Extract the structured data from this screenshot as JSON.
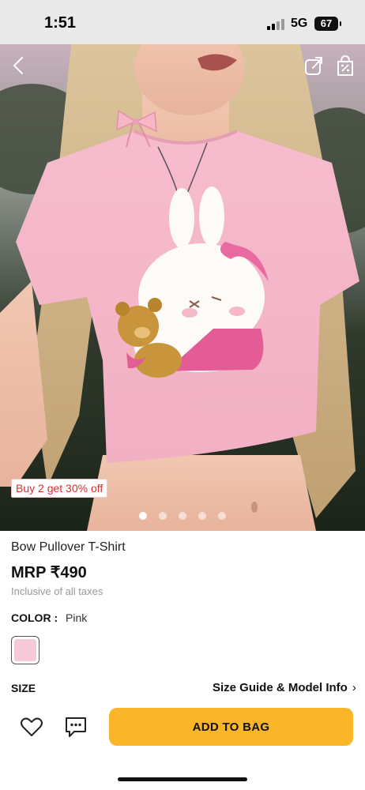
{
  "status_bar": {
    "time": "1:51",
    "network": "5G",
    "battery": "67"
  },
  "product": {
    "promo_badge": "Buy 2 get 30% off",
    "title": "Bow Pullover T-Shirt",
    "price": "MRP ₹490",
    "tax_note": "Inclusive of all taxes",
    "carousel": {
      "total": 5,
      "active_index": 0
    },
    "color": {
      "label": "COLOR :",
      "value": "Pink",
      "swatch_hex": "#f6c9d6"
    },
    "size": {
      "label": "SIZE",
      "guide_link": "Size Guide & Model Info"
    }
  },
  "actions": {
    "add_to_bag": "ADD TO BAG"
  },
  "icons": {
    "back": "back-arrow-icon",
    "share": "share-icon",
    "bag": "shopping-bag-icon",
    "wishlist": "heart-icon",
    "chat": "chat-icon",
    "chevron": "chevron-right-icon"
  },
  "colors": {
    "accent": "#fbb528",
    "promo_text": "#d9302c",
    "shirt_pink": "#f4b6c8"
  }
}
